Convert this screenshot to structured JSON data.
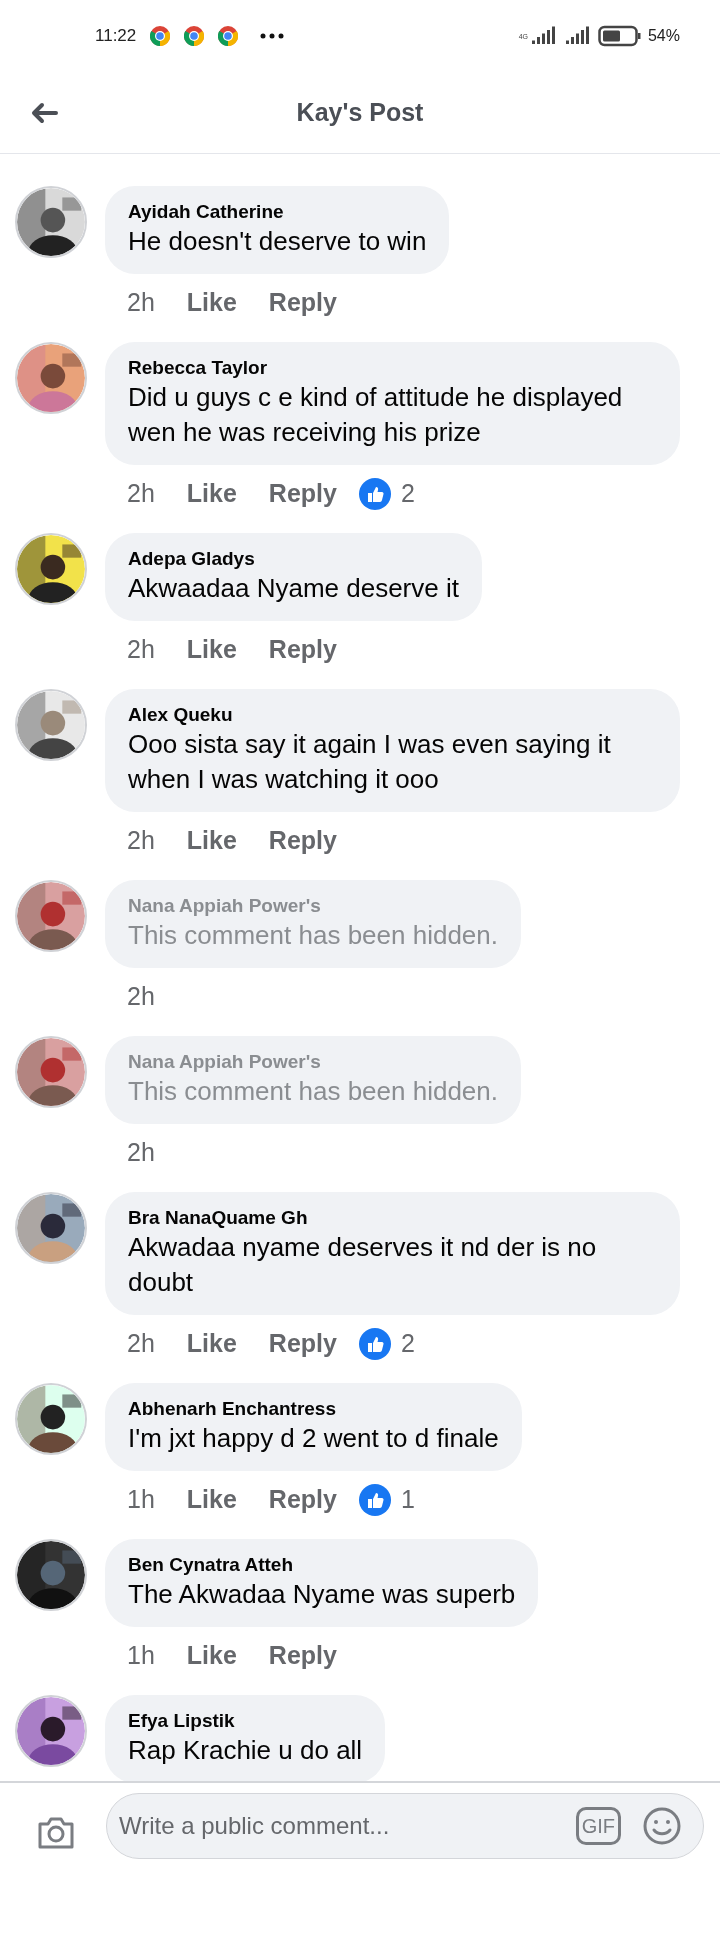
{
  "status_bar": {
    "time": "11:22",
    "network": "4G",
    "battery": "54%"
  },
  "header": {
    "title": "Kay's Post"
  },
  "comments": [
    {
      "kind": "normal",
      "name": "Ayidah Catherine",
      "text": "He doesn't deserve to win",
      "time": "2h",
      "like": "Like",
      "reply": "Reply"
    },
    {
      "kind": "normal",
      "name": "Rebecca Taylor",
      "text": "Did u guys c e kind of attitude he displayed wen he was receiving his prize",
      "time": "2h",
      "like": "Like",
      "reply": "Reply",
      "reactions": "2"
    },
    {
      "kind": "normal",
      "name": "Adepa Gladys",
      "text": "Akwaadaa Nyame deserve it",
      "time": "2h",
      "like": "Like",
      "reply": "Reply"
    },
    {
      "kind": "normal",
      "name": "Alex Queku",
      "text": "Ooo sista say it again I was even saying it when I was watching it ooo",
      "time": "2h",
      "like": "Like",
      "reply": "Reply"
    },
    {
      "kind": "hidden",
      "name": "Nana Appiah Power's",
      "text": "This comment has been hidden.",
      "time": "2h"
    },
    {
      "kind": "hidden",
      "name": "Nana Appiah Power's",
      "text": "This comment has been hidden.",
      "time": "2h"
    },
    {
      "kind": "normal",
      "name": "Bra NanaQuame Gh",
      "text": "Akwadaa nyame deserves it nd der is no doubt",
      "time": "2h",
      "like": "Like",
      "reply": "Reply",
      "reactions": "2"
    },
    {
      "kind": "normal",
      "name": "Abhenarh Enchantress",
      "text": "I'm jxt happy d 2 went to d finale",
      "time": "1h",
      "like": "Like",
      "reply": "Reply",
      "reactions": "1"
    },
    {
      "kind": "normal",
      "name": "Ben Cynatra Atteh",
      "text": "The Akwadaa Nyame was superb",
      "time": "1h",
      "like": "Like",
      "reply": "Reply"
    },
    {
      "kind": "normal",
      "name": "Efya Lipstik",
      "text": "Rap Krachie u do all"
    }
  ],
  "composer": {
    "placeholder": "Write a public comment...",
    "gif": "GIF"
  }
}
